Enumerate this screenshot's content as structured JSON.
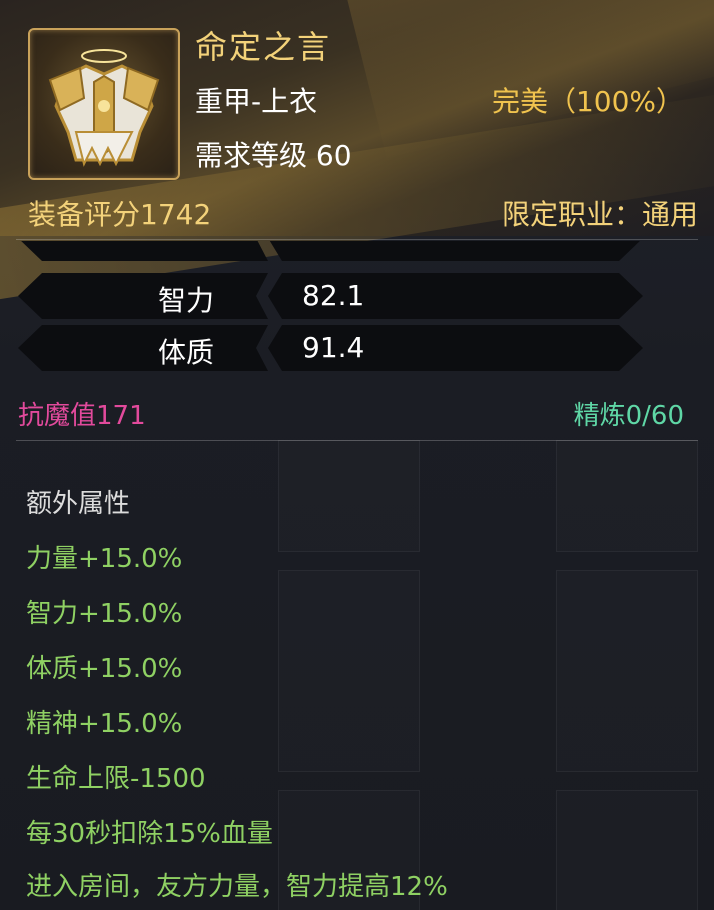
{
  "item": {
    "name": "命定之言",
    "type": "重甲-上衣",
    "required_level": "需求等级 60",
    "quality": "完美（100%）",
    "score": "装备评分1742",
    "class_limit": "限定职业：通用",
    "icon": "golden-chest-armor-icon"
  },
  "stats": [
    {
      "name": "智力",
      "value": "82.1"
    },
    {
      "name": "体质",
      "value": "91.4"
    }
  ],
  "magic_resistance": "抗魔值171",
  "refine": "精炼0/60",
  "extra": {
    "title": "额外属性",
    "items": [
      "力量+15.0%",
      "智力+15.0%",
      "体质+15.0%",
      "精神+15.0%",
      "生命上限-1500",
      "每30秒扣除15%血量",
      "进入房间，友方力量，智力提高12%"
    ]
  },
  "colors": {
    "title_gold": "#f3d27a",
    "quality_gold": "#f0c34e",
    "magic_res_pink": "#e24a9c",
    "refine_green": "#5fd7a6",
    "extra_green": "#8fd163"
  }
}
